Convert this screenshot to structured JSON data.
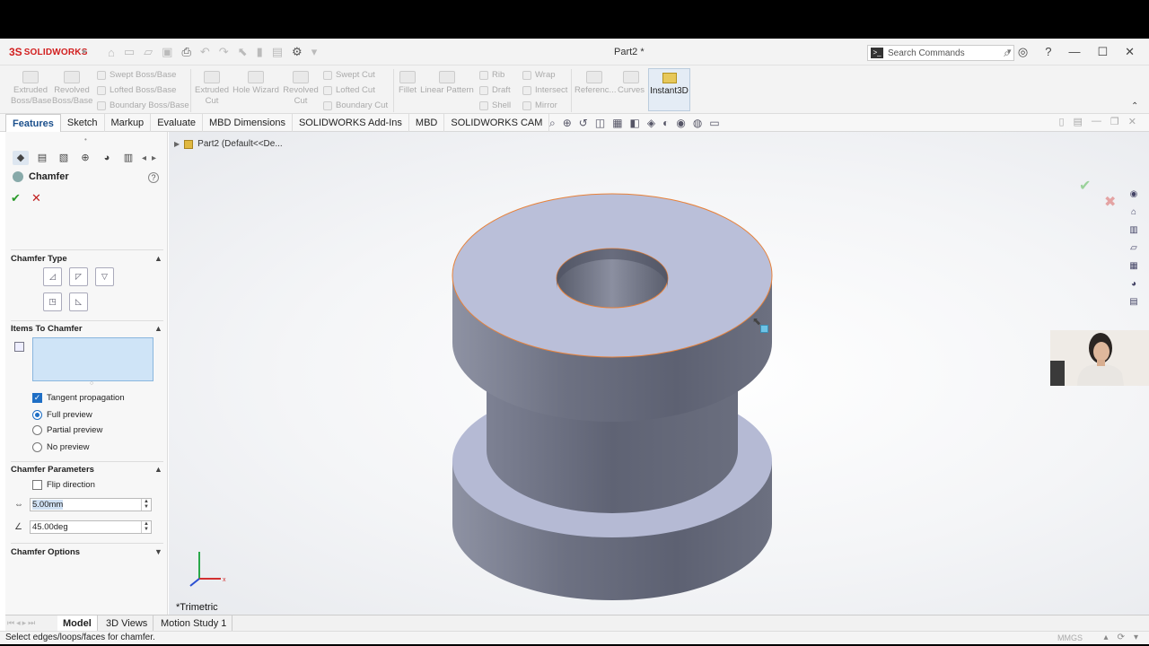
{
  "app": {
    "logo_ds": "3S",
    "logo_text": "SOLIDWORKS",
    "document_title": "Part2 *",
    "search_placeholder": "Search Commands"
  },
  "ribbon": {
    "extruded_boss": [
      "Extruded",
      "Boss/Base"
    ],
    "revolved_boss": [
      "Revolved",
      "Boss/Base"
    ],
    "swept_boss": "Swept Boss/Base",
    "lofted_boss": "Lofted Boss/Base",
    "boundary_boss": "Boundary Boss/Base",
    "extruded_cut": [
      "Extruded",
      "Cut"
    ],
    "hole_wizard": "Hole Wizard",
    "revolved_cut": [
      "Revolved",
      "Cut"
    ],
    "swept_cut": "Swept Cut",
    "lofted_cut": "Lofted Cut",
    "boundary_cut": "Boundary Cut",
    "fillet": "Fillet",
    "linear_pattern": "Linear Pattern",
    "rib": "Rib",
    "draft": "Draft",
    "shell": "Shell",
    "wrap": "Wrap",
    "intersect": "Intersect",
    "mirror": "Mirror",
    "reference": "Referenc...",
    "curves": "Curves",
    "instant3d": "Instant3D"
  },
  "tabs": [
    "Features",
    "Sketch",
    "Markup",
    "Evaluate",
    "MBD Dimensions",
    "SOLIDWORKS Add-Ins",
    "MBD",
    "SOLIDWORKS CAM"
  ],
  "pm": {
    "title": "Chamfer",
    "chamfer_type_label": "Chamfer Type",
    "items_label": "Items To Chamfer",
    "tangent_propagation": "Tangent propagation",
    "full_preview": "Full preview",
    "partial_preview": "Partial preview",
    "no_preview": "No preview",
    "params_label": "Chamfer Parameters",
    "flip_direction": "Flip direction",
    "distance_value": "5.00mm",
    "angle_value": "45.00deg",
    "options_label": "Chamfer Options"
  },
  "viewport": {
    "tree_item": "Part2  (Default<<De...",
    "view_name": "*Trimetric"
  },
  "bottom_tabs": [
    "Model",
    "3D Views",
    "Motion Study 1"
  ],
  "status": {
    "message": "Select edges/loops/faces for chamfer.",
    "units": "MMGS"
  },
  "colors": {
    "accent": "#1f6fc5",
    "part_face": "#b9bed8",
    "part_side": "#6b6f7e",
    "selection_box": "#cfe4f7",
    "edge_highlight": "#e8823a"
  }
}
